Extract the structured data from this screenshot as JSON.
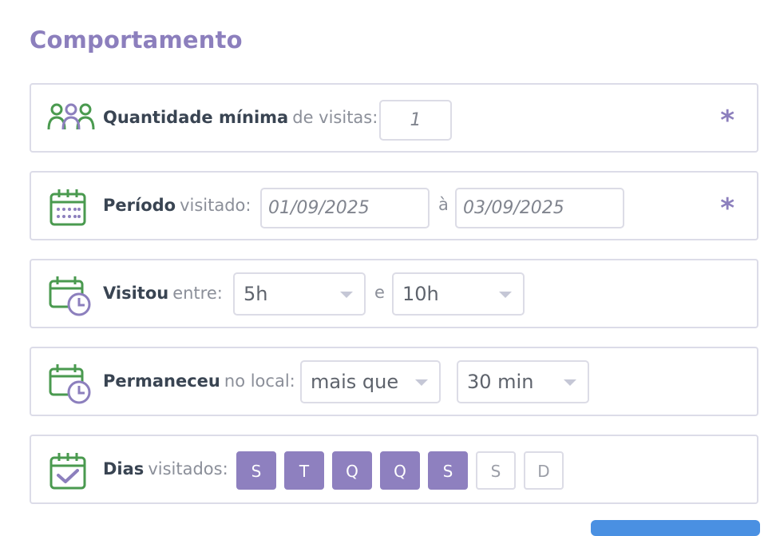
{
  "section": {
    "title": "Comportamento"
  },
  "visits": {
    "label_bold": "Quantidade mínima",
    "label_light": "de visitas:",
    "value": "1",
    "required_mark": "*",
    "icon": "users-icon"
  },
  "period": {
    "label_bold": "Período",
    "label_light": "visitado:",
    "start": "01/09/2025",
    "separator": "à",
    "end": "03/09/2025",
    "required_mark": "*",
    "icon": "calendar-icon"
  },
  "visited_between": {
    "label_bold": "Visitou",
    "label_light": "entre:",
    "from": "5h",
    "separator": "e",
    "to": "10h",
    "icon": "calendar-clock-icon"
  },
  "stayed": {
    "label_bold": "Permaneceu",
    "label_light": "no local:",
    "comparator": "mais que",
    "duration": "30 min",
    "icon": "calendar-clock-icon"
  },
  "days": {
    "label_bold": "Dias",
    "label_light": "visitados:",
    "icon": "calendar-check-icon",
    "items": [
      {
        "label": "S",
        "selected": true
      },
      {
        "label": "T",
        "selected": true
      },
      {
        "label": "Q",
        "selected": true
      },
      {
        "label": "Q",
        "selected": true
      },
      {
        "label": "S",
        "selected": true
      },
      {
        "label": "S",
        "selected": false
      },
      {
        "label": "D",
        "selected": false
      }
    ]
  },
  "colors": {
    "accent": "#8c7fbd",
    "icon_green": "#4a9a4f",
    "border": "#dcdce8"
  }
}
